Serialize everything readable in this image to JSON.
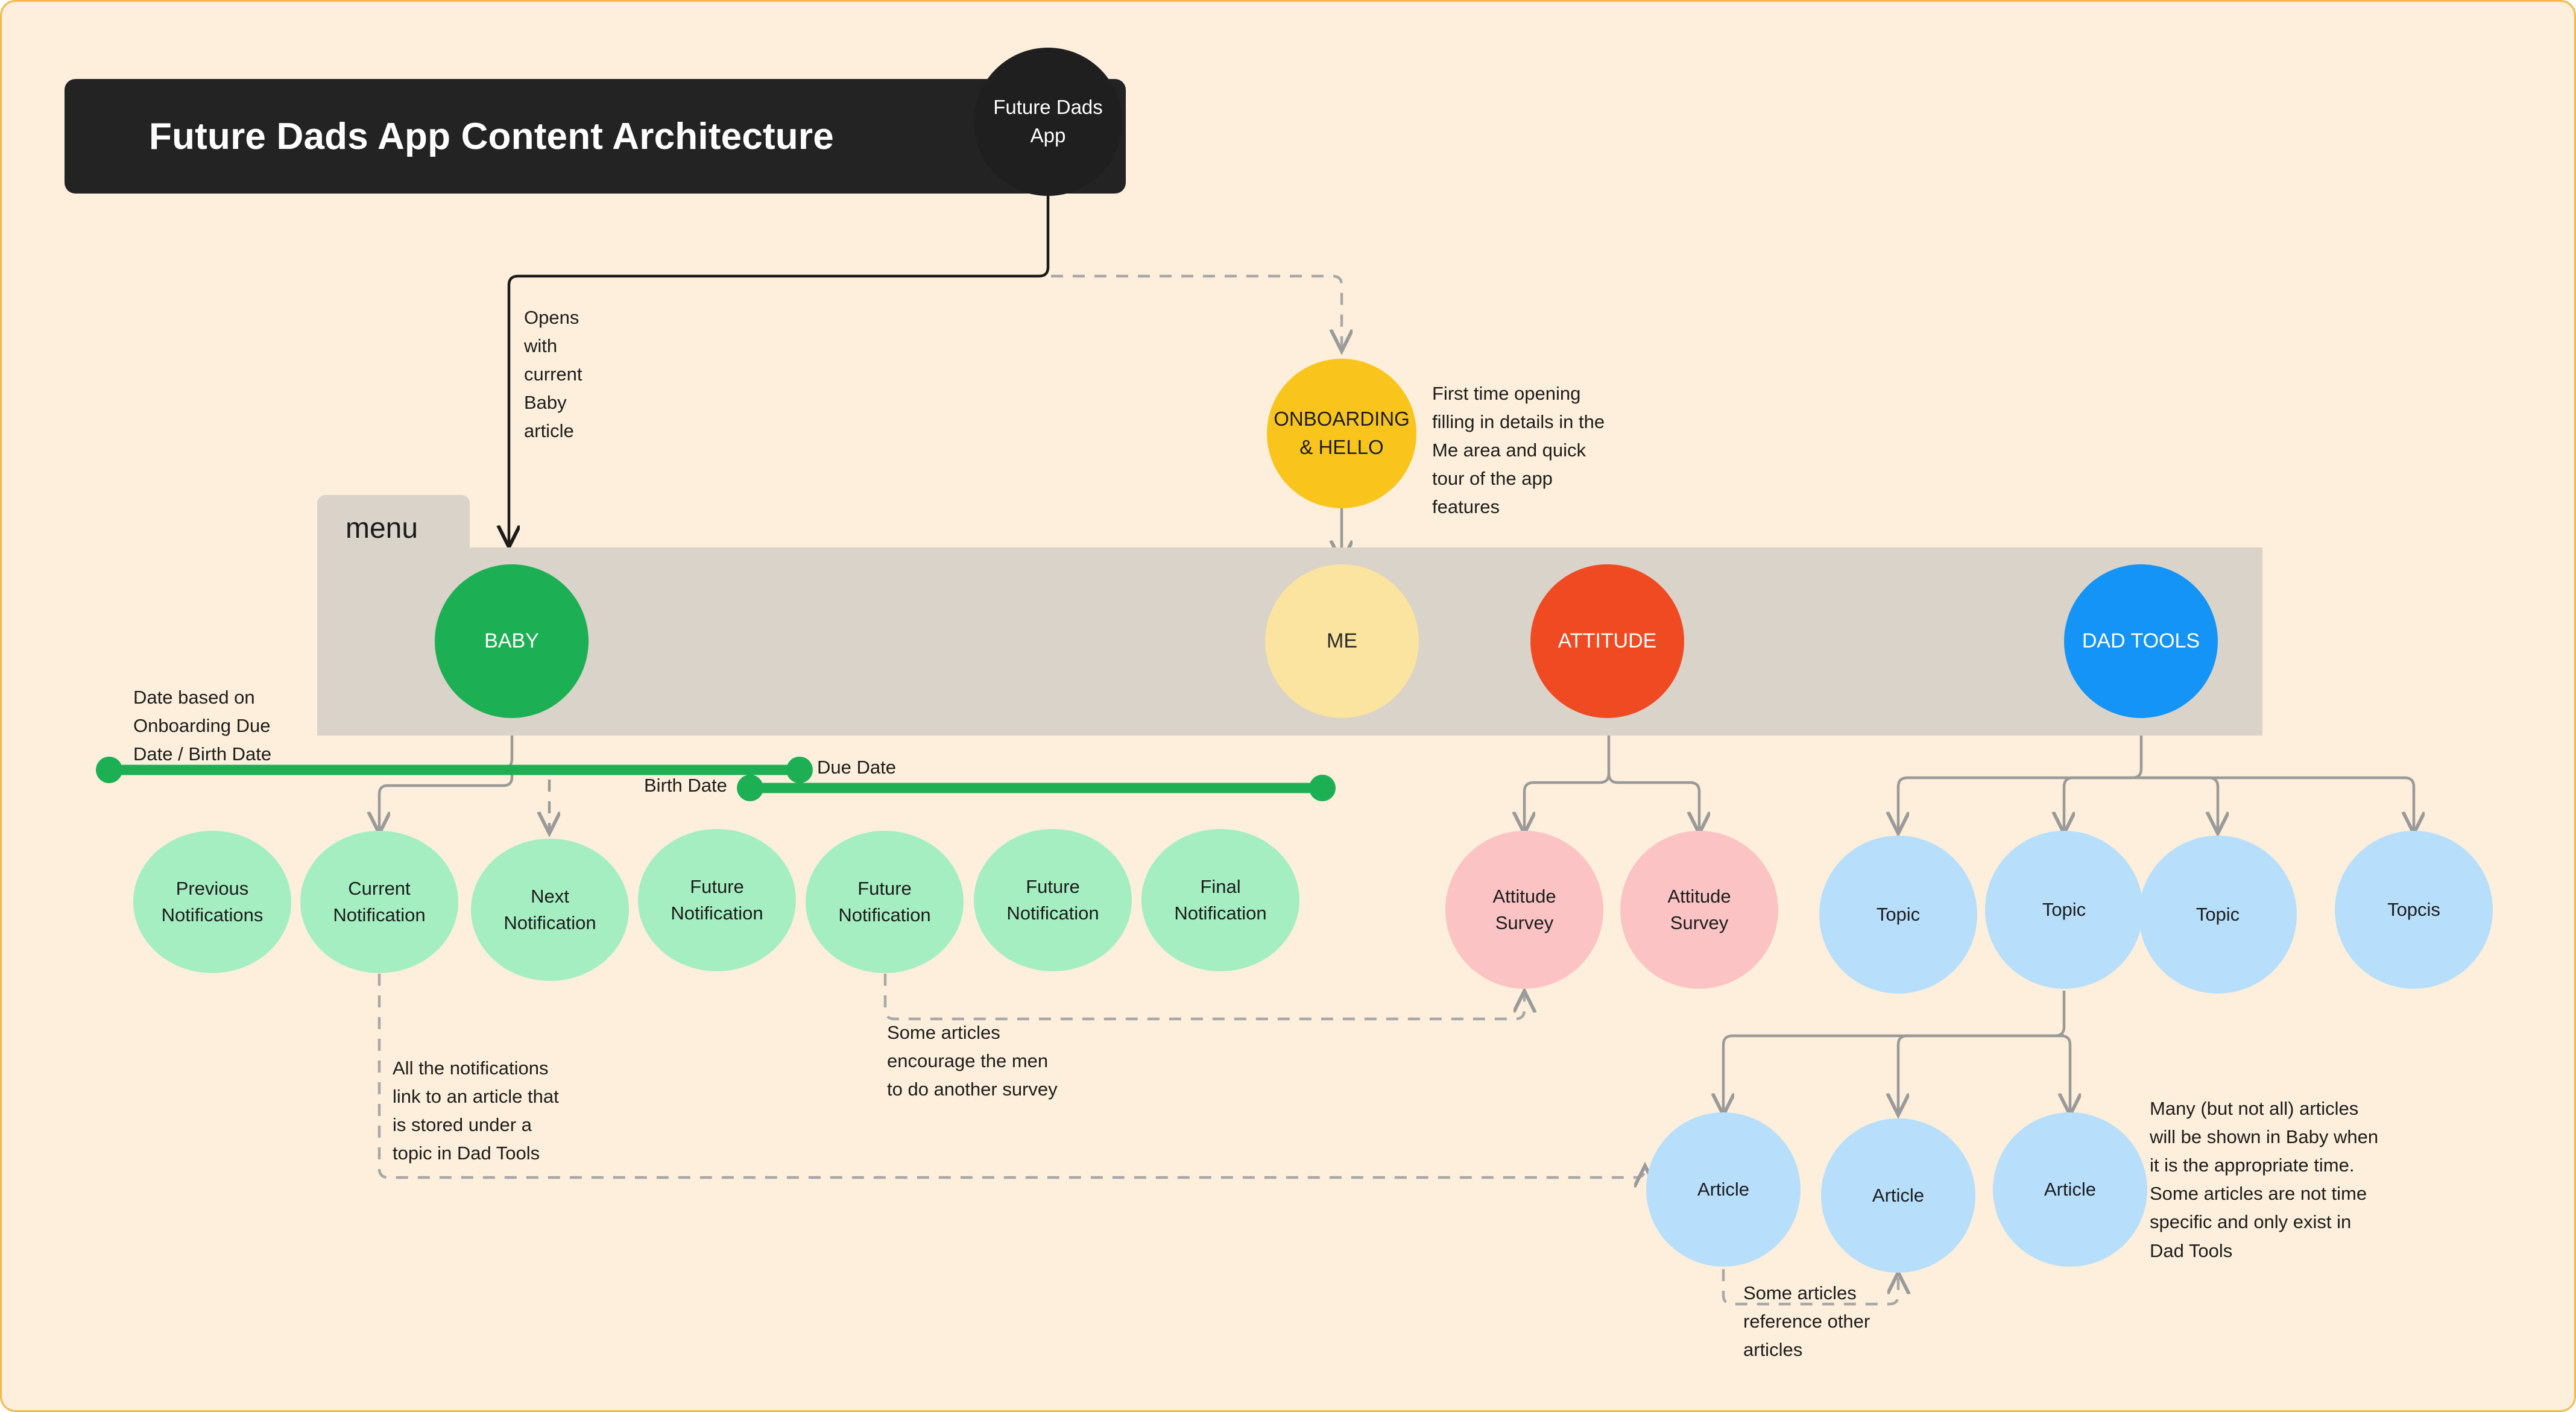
{
  "page": {
    "title": "Future Dads App Content Architecture",
    "root_node": "Future Dads\nApp",
    "accent_bg": "#FDEFDB",
    "frame_border": "#F7B84A"
  },
  "menu": {
    "tab_label": "menu",
    "items": [
      {
        "id": "baby",
        "label": "BABY",
        "color": "#1DAF53"
      },
      {
        "id": "me",
        "label": "ME",
        "color": "#FBE3A0"
      },
      {
        "id": "attitude",
        "label": "ATTITUDE",
        "color": "#F04A23"
      },
      {
        "id": "dadtools",
        "label": "DAD TOOLS",
        "color": "#1494F6"
      }
    ]
  },
  "onboarding": {
    "label": "ONBOARDING\n& HELLO",
    "color": "#F9C51D",
    "note": "First time opening\nfilling in details in the\nMe area and quick\ntour of the app\nfeatures"
  },
  "notes": {
    "opens_with": "Opens\nwith\ncurrent\nBaby\narticle",
    "date_based": "Date based on\nOnboarding Due\nDate / Birth Date",
    "notifications_link": "All the notifications\nlink to an article that\nis stored under a\ntopic in Dad Tools",
    "encourage_survey": "Some articles\nencourage the men\nto do another survey",
    "many_articles": "Many (but not all) articles\nwill be shown in Baby when\nit is the appropriate time.\nSome articles are not time\nspecific and only exist in\nDad Tools",
    "reference_other": "Some articles\nreference other\narticles"
  },
  "timeline": {
    "color": "#1DAF53",
    "due_date_label": "Due Date",
    "birth_date_label": "Birth Date"
  },
  "notifications": [
    {
      "label": "Previous\nNotifications"
    },
    {
      "label": "Current\nNotification"
    },
    {
      "label": "Next\nNotification"
    },
    {
      "label": "Future\nNotification"
    },
    {
      "label": "Future\nNotification"
    },
    {
      "label": "Future\nNotification"
    },
    {
      "label": "Final\nNotification"
    }
  ],
  "surveys": [
    {
      "label": "Attitude\nSurvey"
    },
    {
      "label": "Attitude\nSurvey"
    }
  ],
  "topics": [
    {
      "label": "Topic"
    },
    {
      "label": "Topic"
    },
    {
      "label": "Topic"
    },
    {
      "label": "Topcis"
    }
  ],
  "articles": [
    {
      "label": "Article"
    },
    {
      "label": "Article"
    },
    {
      "label": "Article"
    }
  ]
}
